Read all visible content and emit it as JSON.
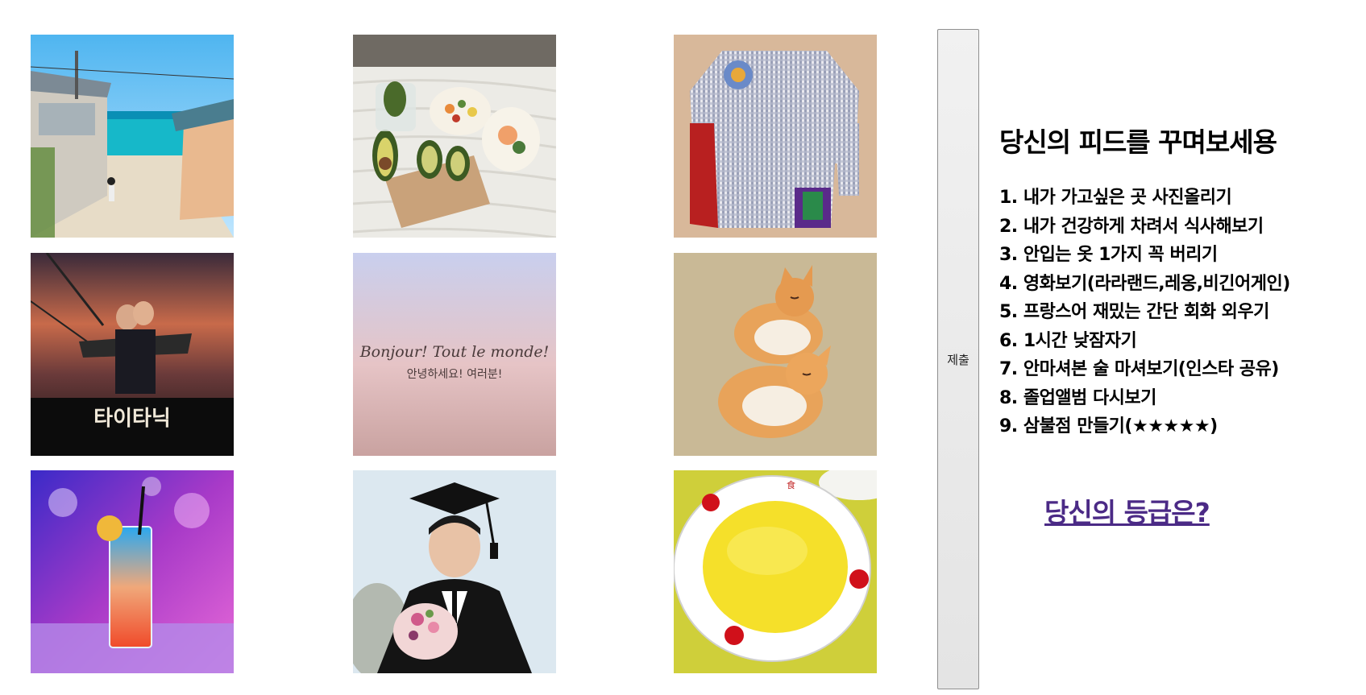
{
  "gallery": {
    "images": [
      {
        "icon": "beach-village-photo"
      },
      {
        "icon": "avocado-meal-photo"
      },
      {
        "icon": "checked-shirt-photo"
      },
      {
        "icon": "titanic-poster-photo",
        "poster_title": "타이타닉"
      },
      {
        "icon": "pastel-greeting-card",
        "line1": "Bonjour! Tout le monde!",
        "line2": "안녕하세요! 여러분!"
      },
      {
        "icon": "sleeping-kittens-photo"
      },
      {
        "icon": "blue-cocktail-photo"
      },
      {
        "icon": "graduate-portrait-photo"
      },
      {
        "icon": "yellow-dessert-plate-photo"
      }
    ]
  },
  "submit_button": {
    "label": "제출"
  },
  "panel": {
    "title": "당신의 피드를 꾸며보세용",
    "tasks": [
      "1. 내가 가고싶은 곳 사진올리기",
      "2. 내가 건강하게 차려서 식사해보기",
      "3. 안입는 옷 1가지 꼭 버리기",
      "4. 영화보기(라라랜드,레옹,비긴어게인)",
      "5. 프랑스어 재밌는 간단 회화 외우기",
      "6. 1시간 낮잠자기",
      "7. 안마셔본 술 마셔보기(인스타 공유)",
      "8. 졸업앨범 다시보기",
      "9. 삼불점 만들기(★★★★★)"
    ],
    "grade_link": "당신의 등급은?"
  },
  "colors": {
    "link": "#4b2a86",
    "button_bg": "#efefef",
    "text": "#000000"
  }
}
